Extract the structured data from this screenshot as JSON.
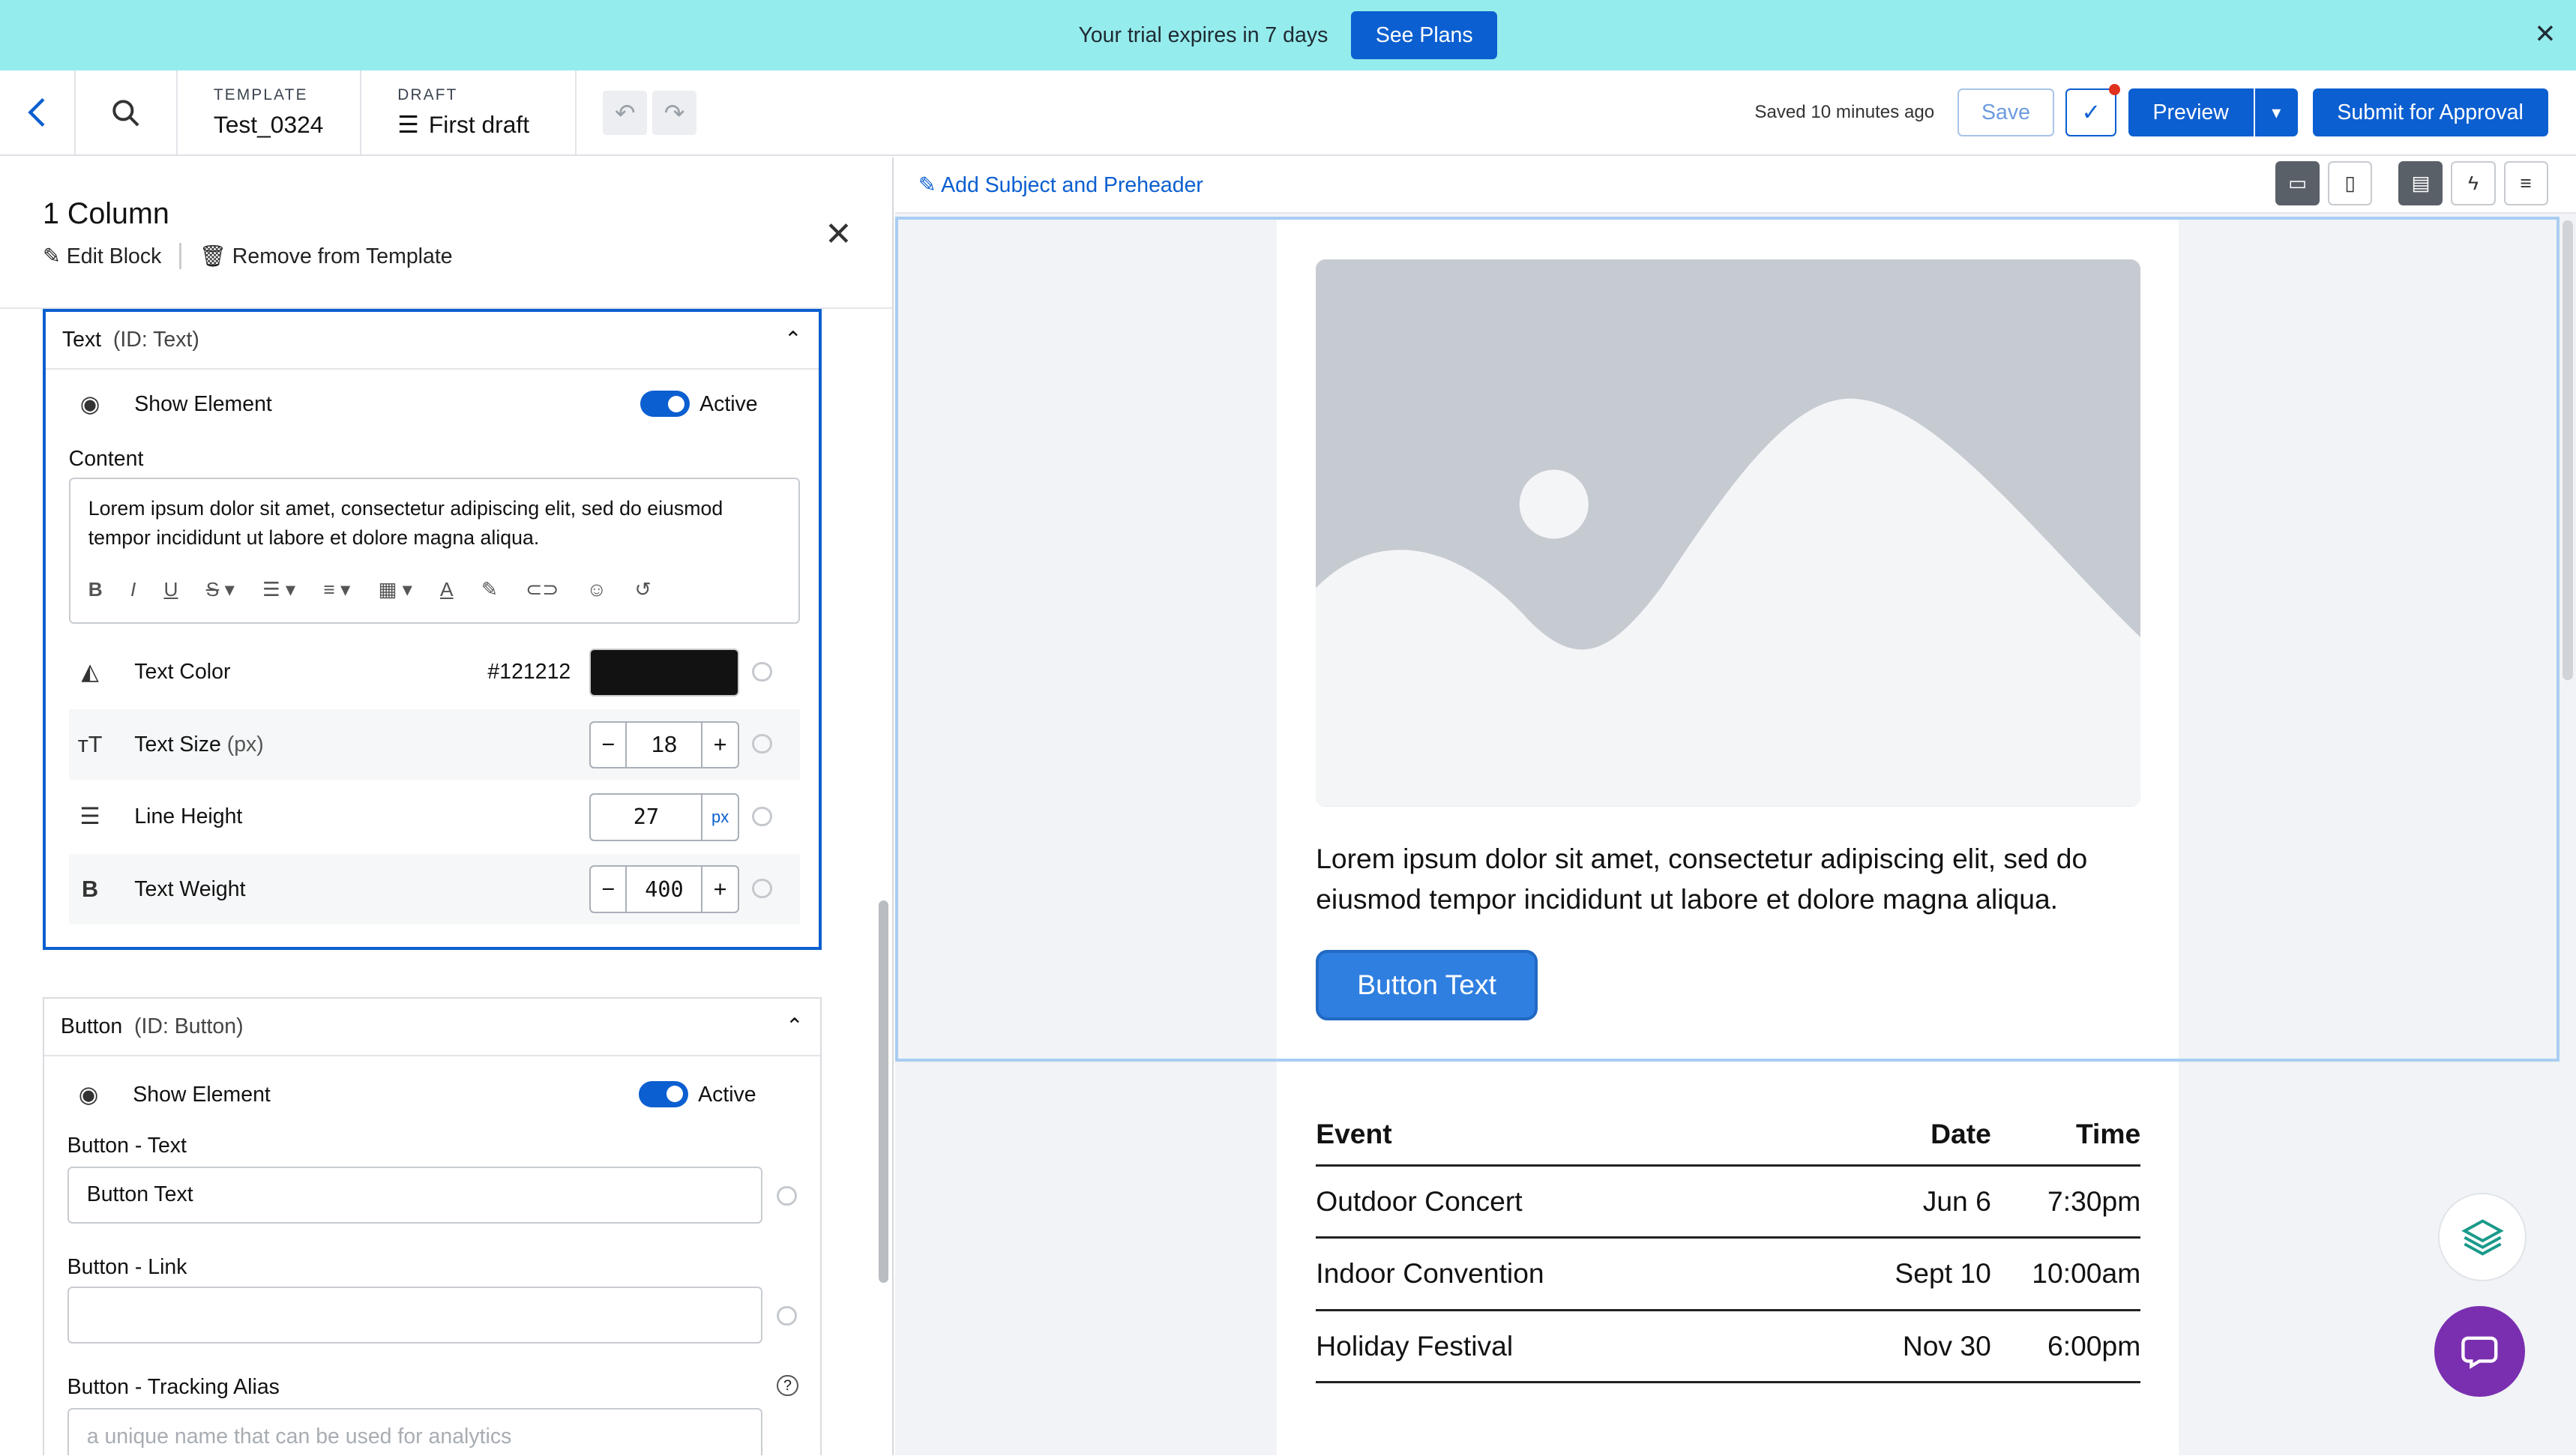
{
  "banner": {
    "message": "Your trial expires in 7 days",
    "cta": "See Plans",
    "close": "✕"
  },
  "header": {
    "back_icon": "chevron-left-icon",
    "search_icon": "search-icon",
    "template_caption": "TEMPLATE",
    "template_name": "Test_0324",
    "draft_caption": "DRAFT",
    "draft_name": "First draft",
    "saved_status": "Saved 10 minutes ago",
    "save_label": "Save",
    "preview_label": "Preview",
    "submit_label": "Submit for Approval"
  },
  "panel": {
    "title": "1 Column",
    "edit_label": "Edit Block",
    "remove_label": "Remove from Template",
    "text_card": {
      "name": "Text",
      "id_label": "(ID: Text)",
      "show_element": "Show Element",
      "active_label": "Active",
      "content_label": "Content",
      "content_value": "Lorem ipsum dolor sit amet, consectetur adipiscing elit, sed do eiusmod tempor incididunt ut labore et dolore magna aliqua.",
      "text_color_label": "Text Color",
      "text_color_value": "#121212",
      "text_size_label": "Text Size",
      "text_size_unit": "(px)",
      "text_size_value": "18",
      "line_height_label": "Line Height",
      "line_height_value": "27",
      "line_height_unit": "px",
      "text_weight_label": "Text Weight",
      "text_weight_value": "400",
      "minus": "−",
      "plus": "+"
    },
    "button_card": {
      "name": "Button",
      "id_label": "(ID: Button)",
      "show_element": "Show Element",
      "active_label": "Active",
      "text_label": "Button - Text",
      "text_value": "Button Text",
      "link_label": "Button - Link",
      "link_value": "",
      "alias_label": "Button - Tracking Alias",
      "alias_placeholder": "a unique name that can be used for analytics"
    }
  },
  "canvas": {
    "subject_link": "Add Subject and Preheader",
    "body_text": "Lorem ipsum dolor sit amet, consectetur adipiscing elit, sed do eiusmod tempor incididunt ut labore et dolore magna aliqua.",
    "button_text": "Button Text",
    "table": {
      "headers": [
        "Event",
        "Date",
        "Time"
      ],
      "rows": [
        [
          "Outdoor Concert",
          "Jun 6",
          "7:30pm"
        ],
        [
          "Indoor Convention",
          "Sept 10",
          "10:00am"
        ],
        [
          "Holiday Festival",
          "Nov 30",
          "6:00pm"
        ]
      ]
    }
  },
  "colors": {
    "accent": "#0b5fd0",
    "banner": "#95ecec",
    "text_color_swatch": "#121212",
    "chat_fab": "#7a2fb0"
  }
}
